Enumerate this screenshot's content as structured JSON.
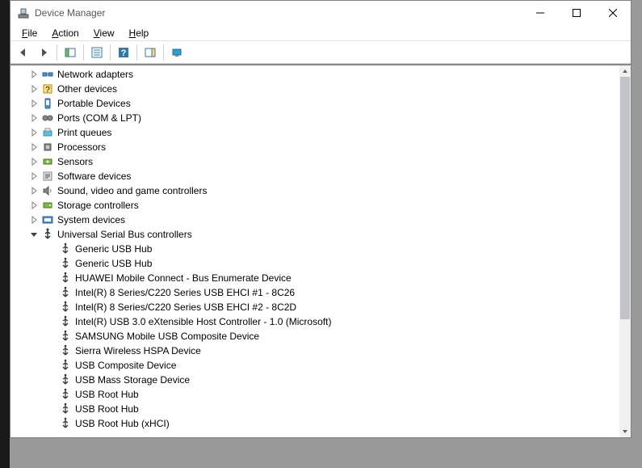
{
  "window": {
    "title": "Device Manager"
  },
  "menu": {
    "file": "File",
    "action": "Action",
    "view": "View",
    "help": "Help"
  },
  "toolbar": {
    "back": "back-icon",
    "forward": "forward-icon",
    "show_hidden": "show-hidden-icon",
    "properties": "properties-icon",
    "help": "help-icon",
    "action": "action-pane-icon",
    "scan": "scan-hardware-icon"
  },
  "tree": {
    "categories": [
      {
        "label": "Network adapters",
        "icon": "network-icon",
        "expanded": false
      },
      {
        "label": "Other devices",
        "icon": "other-icon",
        "expanded": false
      },
      {
        "label": "Portable Devices",
        "icon": "portable-icon",
        "expanded": false
      },
      {
        "label": "Ports (COM & LPT)",
        "icon": "ports-icon",
        "expanded": false
      },
      {
        "label": "Print queues",
        "icon": "printer-icon",
        "expanded": false
      },
      {
        "label": "Processors",
        "icon": "cpu-icon",
        "expanded": false
      },
      {
        "label": "Sensors",
        "icon": "sensor-icon",
        "expanded": false
      },
      {
        "label": "Software devices",
        "icon": "software-icon",
        "expanded": false
      },
      {
        "label": "Sound, video and game controllers",
        "icon": "sound-icon",
        "expanded": false
      },
      {
        "label": "Storage controllers",
        "icon": "storage-icon",
        "expanded": false
      },
      {
        "label": "System devices",
        "icon": "system-icon",
        "expanded": false
      },
      {
        "label": "Universal Serial Bus controllers",
        "icon": "usb-icon",
        "expanded": true,
        "children": [
          {
            "label": "Generic USB Hub"
          },
          {
            "label": "Generic USB Hub"
          },
          {
            "label": "HUAWEI Mobile Connect - Bus Enumerate Device"
          },
          {
            "label": "Intel(R) 8 Series/C220 Series USB EHCI #1 - 8C26"
          },
          {
            "label": "Intel(R) 8 Series/C220 Series USB EHCI #2 - 8C2D"
          },
          {
            "label": "Intel(R) USB 3.0 eXtensible Host Controller - 1.0 (Microsoft)"
          },
          {
            "label": "SAMSUNG Mobile USB Composite Device"
          },
          {
            "label": "Sierra Wireless HSPA Device"
          },
          {
            "label": "USB Composite Device"
          },
          {
            "label": "USB Mass Storage Device"
          },
          {
            "label": "USB Root Hub"
          },
          {
            "label": "USB Root Hub"
          },
          {
            "label": "USB Root Hub (xHCI)"
          }
        ]
      }
    ]
  }
}
